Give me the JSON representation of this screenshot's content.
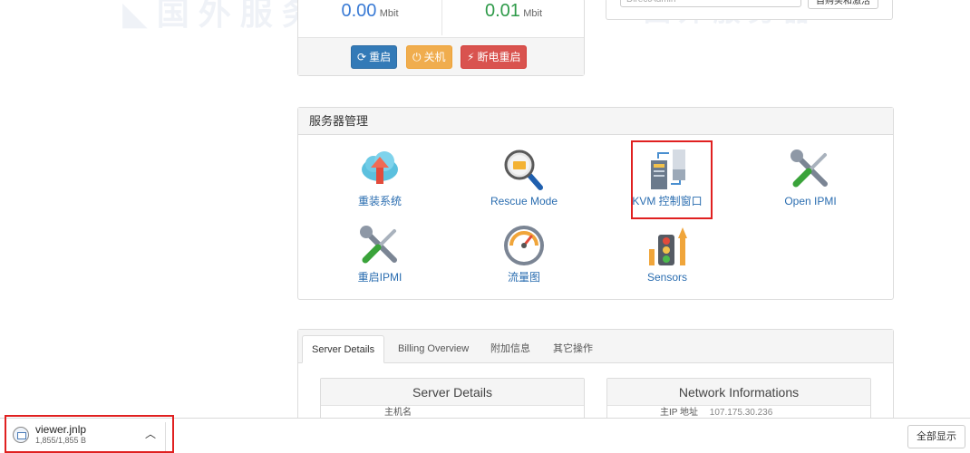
{
  "bandwidth": {
    "left_value": "0.00",
    "left_unit": "Mbit",
    "right_value": "0.01",
    "right_unit": "Mbit",
    "buttons": {
      "reboot": "重启",
      "shutdown": "关机",
      "power_cycle": "断电重启"
    }
  },
  "right_top": {
    "input_value": "DirectAdmin",
    "button_label": "自购买和激活"
  },
  "server_management": {
    "title": "服务器管理",
    "tools": [
      {
        "label": "重装系统",
        "icon": "cloud-upload-icon"
      },
      {
        "label": "Rescue Mode",
        "icon": "magnifier-icon"
      },
      {
        "label": "KVM 控制窗口",
        "icon": "kvm-console-icon"
      },
      {
        "label": "Open IPMI",
        "icon": "wrench-screwdriver-icon"
      },
      {
        "label": "重启IPMI",
        "icon": "wrench-screwdriver-icon"
      },
      {
        "label": "流量图",
        "icon": "gauge-icon"
      },
      {
        "label": "Sensors",
        "icon": "traffic-light-icon"
      }
    ]
  },
  "details": {
    "tabs": [
      "Server Details",
      "Billing Overview",
      "附加信息",
      "其它操作"
    ],
    "active_tab": "Server Details",
    "server_details_title": "Server Details",
    "server_details_row_key": "主机名",
    "network_title": "Network Informations",
    "network_row_key": "主IP 地址",
    "network_row_value": "107.175.30.236"
  },
  "download_bar": {
    "file_name": "viewer.jnlp",
    "file_size": "1,855/1,855 B",
    "show_all": "全部显示"
  },
  "colors": {
    "primary_blue": "#337ab7",
    "warning_orange": "#f0ad4e",
    "danger_red": "#d9534f",
    "highlight_red": "#e02020"
  }
}
